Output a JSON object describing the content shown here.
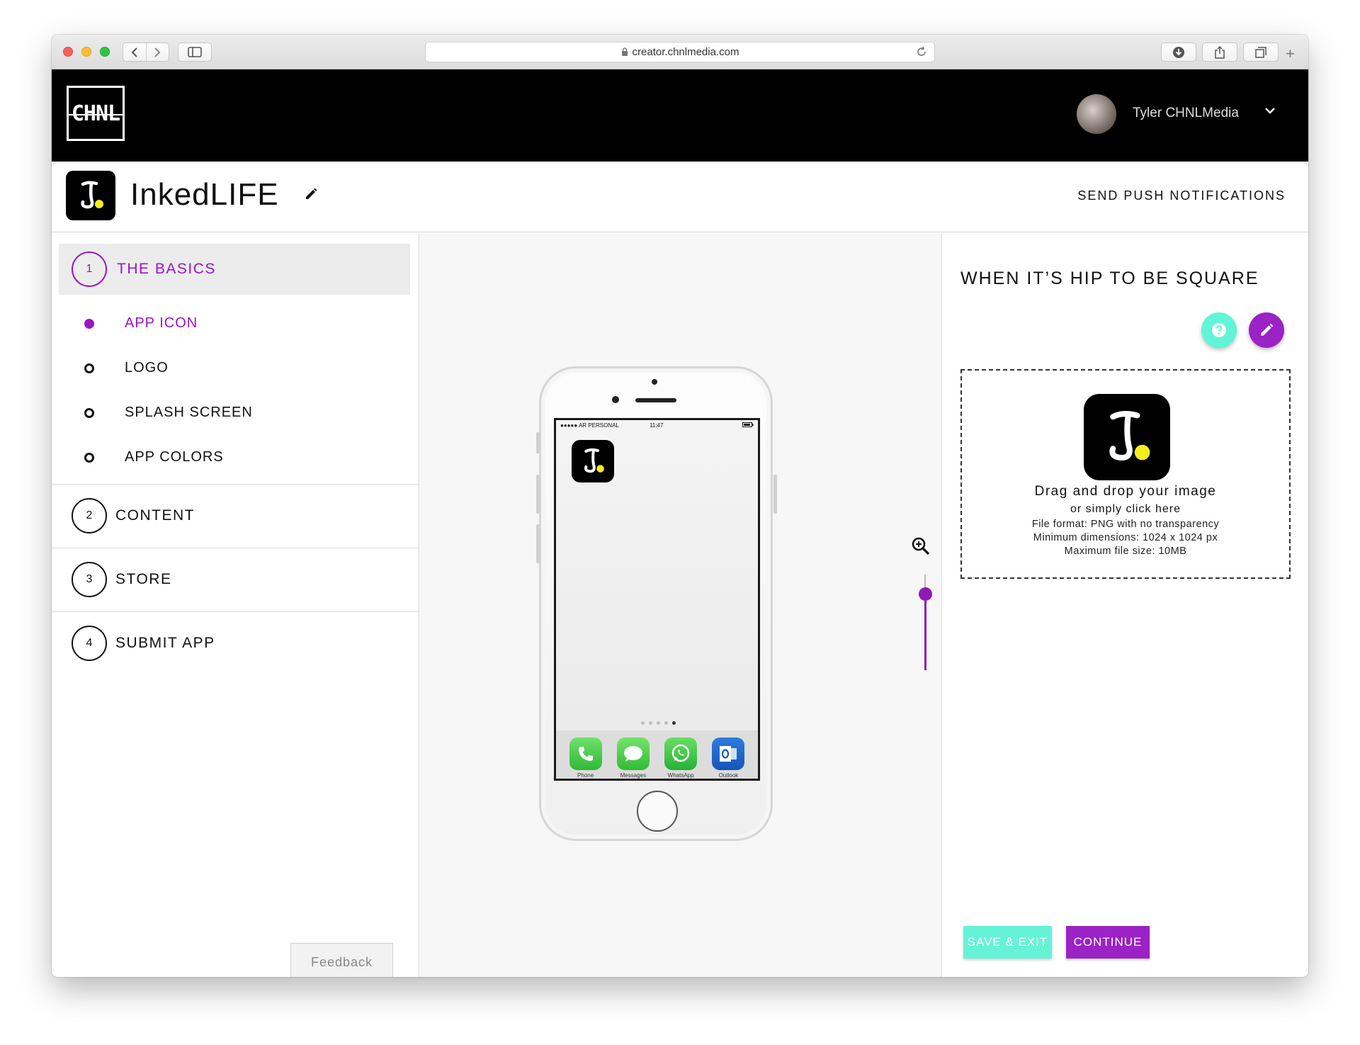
{
  "browser": {
    "url": "creator.chnlmedia.com"
  },
  "header": {
    "logo_text": "CHNL",
    "user_name": "Tyler CHNLMedia"
  },
  "project": {
    "name": "InkedLIFE",
    "push_label": "SEND PUSH NOTIFICATIONS"
  },
  "steps": [
    {
      "number": "1",
      "label": "THE BASICS"
    },
    {
      "number": "2",
      "label": "CONTENT"
    },
    {
      "number": "3",
      "label": "STORE"
    },
    {
      "number": "4",
      "label": "SUBMIT APP"
    }
  ],
  "substeps": [
    {
      "label": "APP ICON",
      "active": true
    },
    {
      "label": "LOGO",
      "active": false
    },
    {
      "label": "SPLASH SCREEN",
      "active": false
    },
    {
      "label": "APP COLORS",
      "active": false
    }
  ],
  "feedback_label": "Feedback",
  "preview": {
    "carrier": "●●●●● AR PERSONAL",
    "time": "11:47",
    "dock": [
      {
        "label": "Phone"
      },
      {
        "label": "Messages"
      },
      {
        "label": "WhatsApp"
      },
      {
        "label": "Outlook"
      }
    ],
    "zoom_level": 0.2
  },
  "panel": {
    "title": "WHEN IT’S HIP TO BE SQUARE",
    "drop_title": "Drag and drop your image",
    "drop_sub": "or simply click here",
    "info": [
      "File format: PNG with no transparency",
      "Minimum dimensions: 1024 x 1024 px",
      "Maximum file size: 10MB"
    ],
    "save_label": "SAVE & EXIT",
    "continue_label": "CONTINUE"
  },
  "colors": {
    "accent_purple": "#9b22c4",
    "accent_teal": "#65f3d7",
    "header_bg": "#000000"
  },
  "icons": [
    "back-icon",
    "forward-icon",
    "sidebar-icon",
    "lock-icon",
    "reload-icon",
    "download-icon",
    "share-icon",
    "tabs-icon",
    "chevron-down-icon",
    "pencil-icon",
    "zoom-in-icon",
    "help-icon",
    "edit-icon"
  ]
}
